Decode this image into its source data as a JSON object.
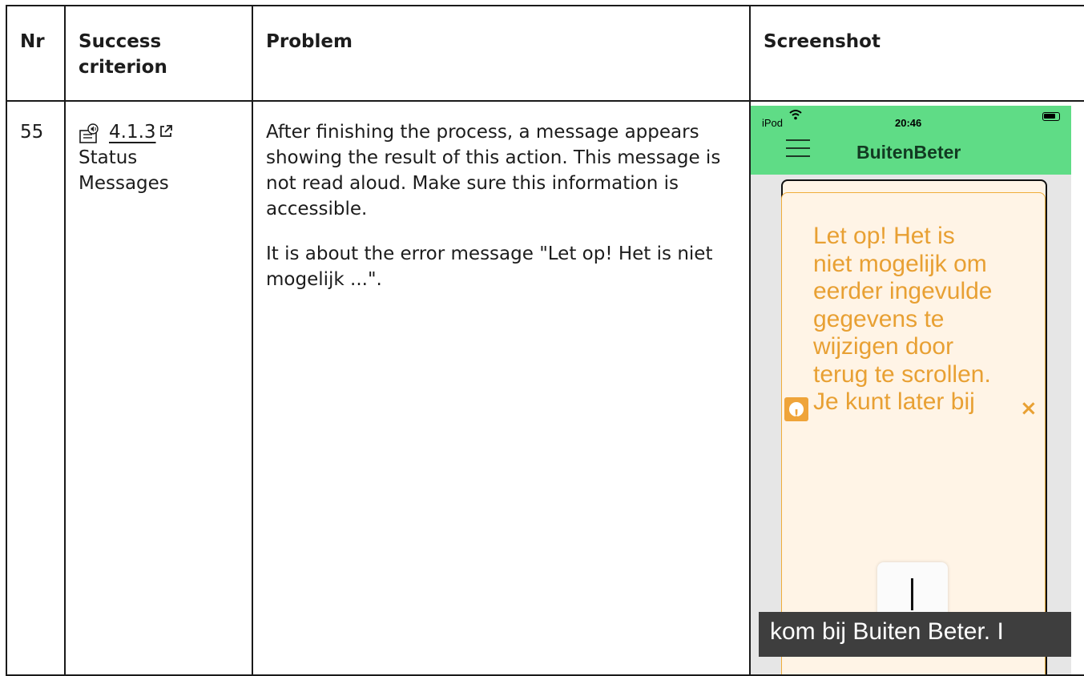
{
  "table": {
    "headers": {
      "nr": "Nr",
      "success_criterion": "Success criterion",
      "problem": "Problem",
      "screenshot": "Screenshot"
    },
    "row": {
      "nr": "55",
      "criterion_number": "4.1.3",
      "criterion_name": "Status Messages",
      "problem_paragraphs": [
        "After finishing the process, a message appears showing the result of this action. This message is not read aloud. Make sure this information is accessible.",
        "It is about the error message \"Let op! Het is niet mogelijk ...\"."
      ]
    }
  },
  "screenshot": {
    "device": "iPod",
    "time": "20:46",
    "app_title": "BuitenBeter",
    "alert_text_visible": "Let op! Het is niet mogelijk om eerder ingevulde gegevens te wijzigen door terug te scrollen. Je kunt later bij",
    "alert_close_symbol": "×",
    "alert_icon_symbol": "!",
    "caption_text": "kom bij Buiten Beter. I",
    "colors": {
      "nav_bg": "#5fdc86",
      "alert_fg": "#e8a033",
      "alert_bg": "#fff4e6",
      "caption_bg": "#3e3e3e"
    }
  }
}
